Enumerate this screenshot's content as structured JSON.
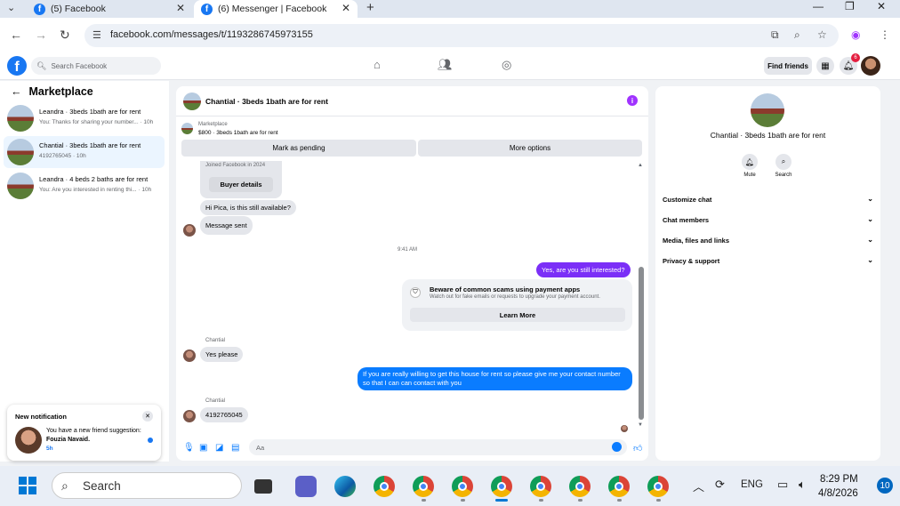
{
  "browser": {
    "tabs": [
      {
        "title": "(5) Facebook",
        "active": false
      },
      {
        "title": "(6) Messenger | Facebook",
        "active": true
      }
    ],
    "url": "facebook.com/messages/t/1193286745973155"
  },
  "fb_header": {
    "search_placeholder": "Search Facebook",
    "find_friends": "Find friends",
    "notification_count": "6"
  },
  "sidebar": {
    "title": "Marketplace",
    "conversations": [
      {
        "name": "Leandra · 3beds 1bath are for rent",
        "snippet": "You: Thanks for sharing your number... · 10h",
        "active": false
      },
      {
        "name": "Chantial · 3beds 1bath are for rent",
        "snippet": "4192765045 · 10h",
        "active": true
      },
      {
        "name": "Leandra · 4 beds 2 baths are for rent",
        "snippet": "You: Are you interested in renting thi... · 10h",
        "active": false
      }
    ]
  },
  "notification": {
    "title": "New notification",
    "text_prefix": "You have a new friend suggestion: ",
    "text_name": "Fouzia Navaid.",
    "time": "5h"
  },
  "chat": {
    "title": "Chantial · 3beds 1bath are for rent",
    "marketplace_label": "Marketplace",
    "listing": "$800 · 3beds 1bath are for rent",
    "mark_pending": "Mark as pending",
    "more_options": "More options",
    "joined": "Joined Facebook in 2024",
    "buyer_details": "Buyer details",
    "msg_hi": "Hi Pica, is this still available?",
    "msg_sent": "Message sent",
    "timestamp": "9:41 AM",
    "msg_interested": "Yes, are you still interested?",
    "scam_title": "Beware of common scams using payment apps",
    "scam_sub": "Watch out for fake emails or requests to upgrade your payment account.",
    "learn_more": "Learn More",
    "sender1": "Chantial",
    "msg_yes": "Yes please",
    "msg_long": "If you are really willing to get this house for rent so please give me your contact number so that I can can contact with you",
    "sender2": "Chantial",
    "msg_number": "4192765045",
    "composer_placeholder": "Aa"
  },
  "right_panel": {
    "name": "Chantial · 3beds 1bath are for rent",
    "mute": "Mute",
    "search": "Search",
    "rows": [
      "Customize chat",
      "Chat members",
      "Media, files and links",
      "Privacy & support"
    ]
  },
  "taskbar": {
    "search": "Search",
    "lang": "ENG",
    "time": "8:29 PM",
    "date": "4/8/2026",
    "notif_count": "10"
  }
}
